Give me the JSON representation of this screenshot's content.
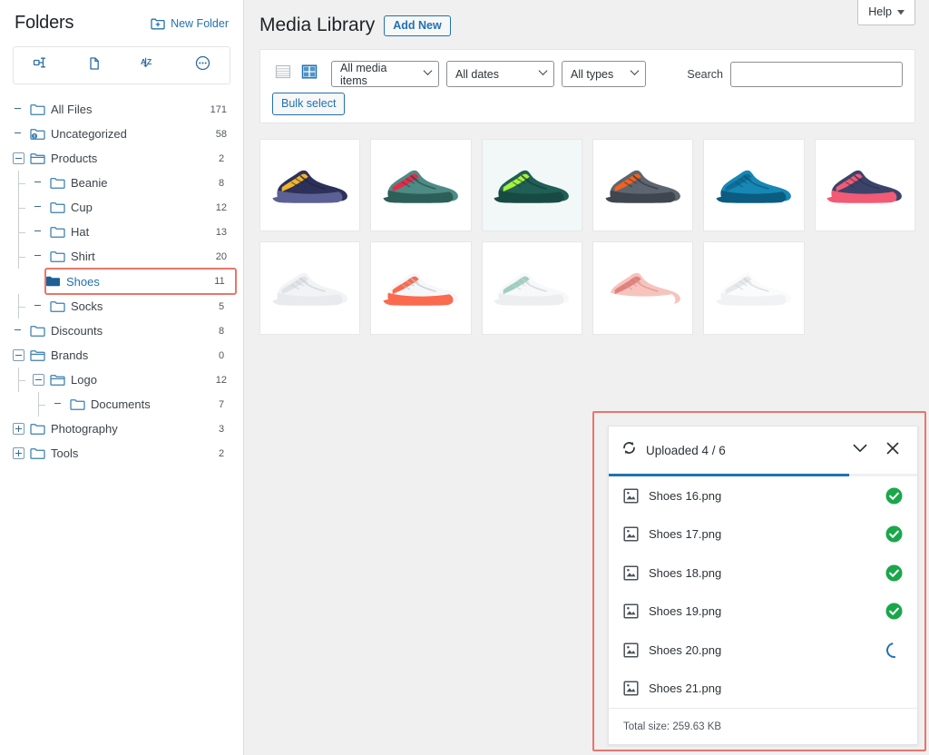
{
  "sidebar": {
    "title": "Folders",
    "new_folder_label": "New Folder",
    "toolbar": [
      {
        "name": "organize-tree-icon",
        "tooltip": "Organize"
      },
      {
        "name": "new-file-icon",
        "tooltip": "New"
      },
      {
        "name": "sort-az-icon",
        "tooltip": "Sort A-Z"
      },
      {
        "name": "more-options-icon",
        "tooltip": "More"
      }
    ],
    "items": [
      {
        "label": "All Files",
        "count": "171",
        "depth": 0,
        "toggle": "none",
        "icon": "folder",
        "selected": false
      },
      {
        "label": "Uncategorized",
        "count": "58",
        "depth": 0,
        "toggle": "none",
        "icon": "folder-uncategorized",
        "selected": false
      },
      {
        "label": "Products",
        "count": "2",
        "depth": 0,
        "toggle": "minus",
        "icon": "folder-open",
        "selected": false
      },
      {
        "label": "Beanie",
        "count": "8",
        "depth": 1,
        "toggle": "none",
        "icon": "folder",
        "selected": false
      },
      {
        "label": "Cup",
        "count": "12",
        "depth": 1,
        "toggle": "none",
        "icon": "folder",
        "selected": false
      },
      {
        "label": "Hat",
        "count": "13",
        "depth": 1,
        "toggle": "none",
        "icon": "folder",
        "selected": false
      },
      {
        "label": "Shirt",
        "count": "20",
        "depth": 1,
        "toggle": "none",
        "icon": "folder",
        "selected": false
      },
      {
        "label": "Shoes",
        "count": "11",
        "depth": 1,
        "toggle": "none",
        "icon": "folder-filled",
        "selected": true
      },
      {
        "label": "Socks",
        "count": "5",
        "depth": 1,
        "toggle": "none",
        "icon": "folder",
        "selected": false
      },
      {
        "label": "Discounts",
        "count": "8",
        "depth": 0,
        "toggle": "none",
        "icon": "folder",
        "selected": false
      },
      {
        "label": "Brands",
        "count": "0",
        "depth": 0,
        "toggle": "minus",
        "icon": "folder-open",
        "selected": false
      },
      {
        "label": "Logo",
        "count": "12",
        "depth": 1,
        "toggle": "minus",
        "icon": "folder-open",
        "selected": false
      },
      {
        "label": "Documents",
        "count": "7",
        "depth": 2,
        "toggle": "none",
        "icon": "folder",
        "selected": false
      },
      {
        "label": "Photography",
        "count": "3",
        "depth": 0,
        "toggle": "plus",
        "icon": "folder",
        "selected": false
      },
      {
        "label": "Tools",
        "count": "2",
        "depth": 0,
        "toggle": "plus",
        "icon": "folder",
        "selected": false
      }
    ]
  },
  "header": {
    "help_label": "Help",
    "page_title": "Media Library",
    "add_new_label": "Add New"
  },
  "filters": {
    "list_view_icon": "list-view-icon",
    "grid_view_icon": "grid-view-icon",
    "media_items": "All media items",
    "dates": "All dates",
    "types": "All types",
    "search_label": "Search",
    "search_value": "",
    "search_placeholder": "",
    "bulk_select_label": "Bulk select"
  },
  "grid": {
    "items": [
      {
        "name": "shoe-navy-yellow",
        "selected": false,
        "colors": {
          "body": "#2d3159",
          "accent": "#f2b429",
          "sole": "#5b6194",
          "detail": "#1f2342"
        }
      },
      {
        "name": "shoe-teal-red",
        "selected": false,
        "colors": {
          "body": "#4d8b84",
          "accent": "#e8294a",
          "sole": "#2c5f58",
          "detail": "#1f4a45"
        }
      },
      {
        "name": "shoe-green-lime",
        "selected": true,
        "colors": {
          "body": "#1f5f55",
          "accent": "#a9f03c",
          "sole": "#174a43",
          "detail": "#123a35"
        }
      },
      {
        "name": "shoe-orange-grey",
        "selected": false,
        "colors": {
          "body": "#5c6570",
          "accent": "#f4601d",
          "sole": "#3f464f",
          "detail": "#2e343b"
        }
      },
      {
        "name": "shoe-blue",
        "selected": false,
        "colors": {
          "body": "#1787b5",
          "accent": "#0e6d96",
          "sole": "#0b5c80",
          "detail": "#0a5472"
        }
      },
      {
        "name": "shoe-navy-pink",
        "selected": false,
        "colors": {
          "body": "#3b4468",
          "accent": "#f25a75",
          "sole": "#f25a75",
          "detail": "#2b3252"
        }
      },
      {
        "name": "shoe-white-grey",
        "selected": false,
        "colors": {
          "body": "#f2f3f5",
          "accent": "#dfe2e6",
          "sole": "#e8eaed",
          "detail": "#c9ced4"
        }
      },
      {
        "name": "shoe-white-coral",
        "selected": false,
        "colors": {
          "body": "#f6f7f8",
          "accent": "#fa6a4f",
          "sole": "#fa6a4f",
          "detail": "#b9bec5"
        }
      },
      {
        "name": "shoe-white-mint",
        "selected": false,
        "colors": {
          "body": "#f7f8f9",
          "accent": "#9ecfbe",
          "sole": "#eceef0",
          "detail": "#c7ccd2"
        }
      },
      {
        "name": "shoe-pink",
        "selected": false,
        "colors": {
          "body": "#f6c4bd",
          "accent": "#e0817c",
          "sole": "#ffffff",
          "detail": "#d9918c"
        }
      },
      {
        "name": "shoe-white-plain",
        "selected": false,
        "colors": {
          "body": "#fafbfb",
          "accent": "#e6e9ec",
          "sole": "#f0f2f4",
          "detail": "#cfd4d9"
        }
      }
    ]
  },
  "upload": {
    "status_title": "Uploaded 4 / 6",
    "progress_percent": 78,
    "collapse_icon": "chevron-down-icon",
    "close_icon": "close-icon",
    "refresh_icon": "refresh-icon",
    "files": [
      {
        "name": "Shoes 16.png",
        "state": "done"
      },
      {
        "name": "Shoes 17.png",
        "state": "done"
      },
      {
        "name": "Shoes 18.png",
        "state": "done"
      },
      {
        "name": "Shoes 19.png",
        "state": "done"
      },
      {
        "name": "Shoes 20.png",
        "state": "loading"
      },
      {
        "name": "Shoes 21.png",
        "state": "pending"
      }
    ],
    "total_size_label": "Total size: 259.63 KB"
  },
  "colors": {
    "accent_blue": "#2271b1",
    "highlight_red": "#e8766b",
    "success_green": "#1aa74a",
    "page_bg": "#f0f0f1"
  }
}
